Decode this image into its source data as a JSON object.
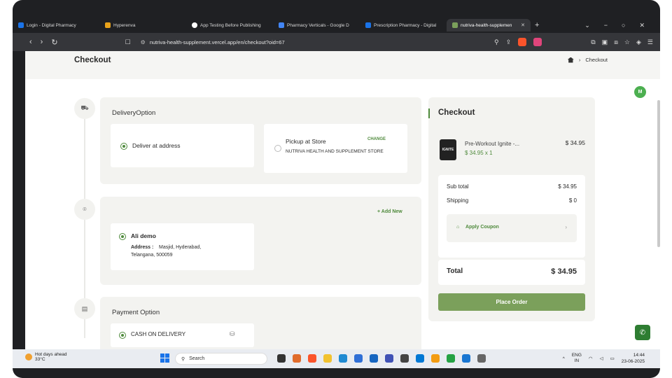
{
  "browser": {
    "tabs": [
      {
        "label": "Login - Digital Pharmacy",
        "color": "#1a73e8"
      },
      {
        "label": "Hyperenva",
        "color": "#e8a21a"
      },
      {
        "label": "App Testing Before Publishing",
        "color": "#ffffff"
      },
      {
        "label": "Pharmacy Verticals - Google D",
        "color": "#4285f4"
      },
      {
        "label": "Prescription Pharmacy - Digital",
        "color": "#1a73e8"
      },
      {
        "label": "nutriva-health-supplemen",
        "color": "#7ba05b"
      }
    ],
    "url": "nutriva-health-supplement.vercel.app/en/checkout?oid=67"
  },
  "page": {
    "title": "Checkout",
    "breadcrumb": "Checkout",
    "avatar": "M"
  },
  "delivery": {
    "title": "DeliveryOption",
    "option1": "Deliver at address",
    "option2_title": "Pickup at Store",
    "option2_change": "CHANGE",
    "option2_store": "NUTRIVA HEALTH AND SUPPLEMENT STORE"
  },
  "address": {
    "add_new": "+ Add New",
    "name": "Ali demo",
    "label": "Address :",
    "line1": "Masjid, Hyderabad,",
    "line2": "Telangana, 500059"
  },
  "payment": {
    "title": "Payment Option",
    "method": "CASH ON DELIVERY"
  },
  "summary": {
    "title": "Checkout",
    "product_img": "IGNITE",
    "product_name": "Pre-Workout Ignite -...",
    "product_qty": "$ 34.95 x 1",
    "product_price": "$ 34.95",
    "subtotal_label": "Sub total",
    "subtotal": "$ 34.95",
    "shipping_label": "Shipping",
    "shipping": "$ 0",
    "coupon": "Apply Coupon",
    "total_label": "Total",
    "total": "$ 34.95",
    "place_order": "Place Order"
  },
  "taskbar": {
    "weather_title": "Hot days ahead",
    "weather_temp": "33°C",
    "search": "Search",
    "lang1": "ENG",
    "lang2": "IN",
    "time": "14:44",
    "date": "23-06-2025"
  }
}
